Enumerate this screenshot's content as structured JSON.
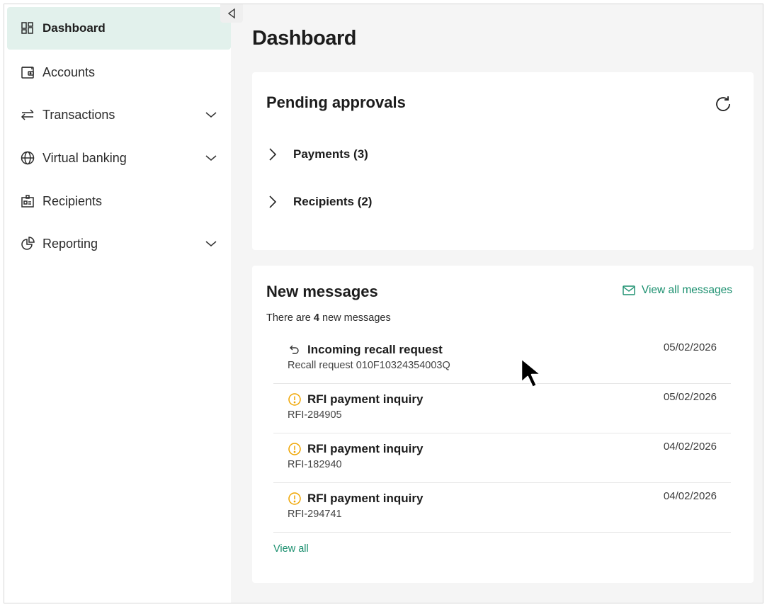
{
  "sidebar": {
    "collapse_icon": "collapse-left-icon",
    "items": [
      {
        "label": "Dashboard",
        "icon": "dashboard-icon",
        "active": true
      },
      {
        "label": "Accounts",
        "icon": "wallet-icon"
      },
      {
        "label": "Transactions",
        "icon": "transfer-arrows-icon",
        "expandable": true
      },
      {
        "label": "Virtual banking",
        "icon": "globe-icon",
        "expandable": true
      },
      {
        "label": "Recipients",
        "icon": "contact-card-icon"
      },
      {
        "label": "Reporting",
        "icon": "pie-chart-icon",
        "expandable": true
      }
    ]
  },
  "main": {
    "title": "Dashboard",
    "pending": {
      "title": "Pending approvals",
      "rows": [
        {
          "label": "Payments (3)"
        },
        {
          "label": "Recipients (2)"
        }
      ]
    },
    "messages": {
      "title": "New messages",
      "view_all_messages": "View all messages",
      "summary_prefix": "There are",
      "count": "4",
      "summary_suffix": "new messages",
      "items": [
        {
          "title": "Incoming recall request",
          "sub": "Recall request 010F10324354003Q",
          "date": "05/02/2026",
          "icon": "undo-arrow-icon"
        },
        {
          "title": "RFI payment inquiry",
          "sub": "RFI-284905",
          "date": "05/02/2026",
          "icon": "warning-circle-icon"
        },
        {
          "title": "RFI payment inquiry",
          "sub": "RFI-182940",
          "date": "04/02/2026",
          "icon": "warning-circle-icon"
        },
        {
          "title": "RFI payment inquiry",
          "sub": "RFI-294741",
          "date": "04/02/2026",
          "icon": "warning-circle-icon"
        }
      ],
      "view_all": "View all"
    }
  },
  "colors": {
    "accent": "#1a8f6e",
    "active_nav_bg": "#e2f1ec",
    "warning": "#f0a500"
  }
}
